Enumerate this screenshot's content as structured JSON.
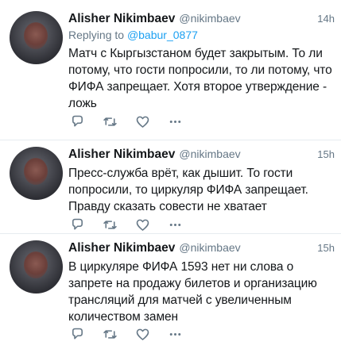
{
  "tweets": [
    {
      "name": "Alisher Nikimbaev",
      "handle": "@nikimbaev",
      "time": "14h",
      "reply_prefix": "Replying to",
      "reply_to": "@babur_0877",
      "text": "Матч с Кыргызстаном будет закрытым. То ли потому, что гости попросили, то ли потому, что ФИФА запрещает. Хотя второе утверждение - ложь"
    },
    {
      "name": "Alisher Nikimbaev",
      "handle": "@nikimbaev",
      "time": "15h",
      "text": "Пресс-служба врёт, как дышит. То гости попросили, то циркуляр ФИФА запрещает. Правду сказать совести не хватает"
    },
    {
      "name": "Alisher Nikimbaev",
      "handle": "@nikimbaev",
      "time": "15h",
      "text": "В циркуляре ФИФА 1593 нет ни слова о запрете на продажу билетов и организацию трансляций для матчей с увеличенным количеством замен"
    }
  ],
  "icons": {
    "reply": "reply-icon",
    "retweet": "retweet-icon",
    "like": "like-icon",
    "more": "more-icon"
  },
  "colors": {
    "text": "#14171a",
    "secondary": "#657786",
    "link": "#1da1f2",
    "icon": "#657786",
    "divider": "#e6ecf0"
  }
}
